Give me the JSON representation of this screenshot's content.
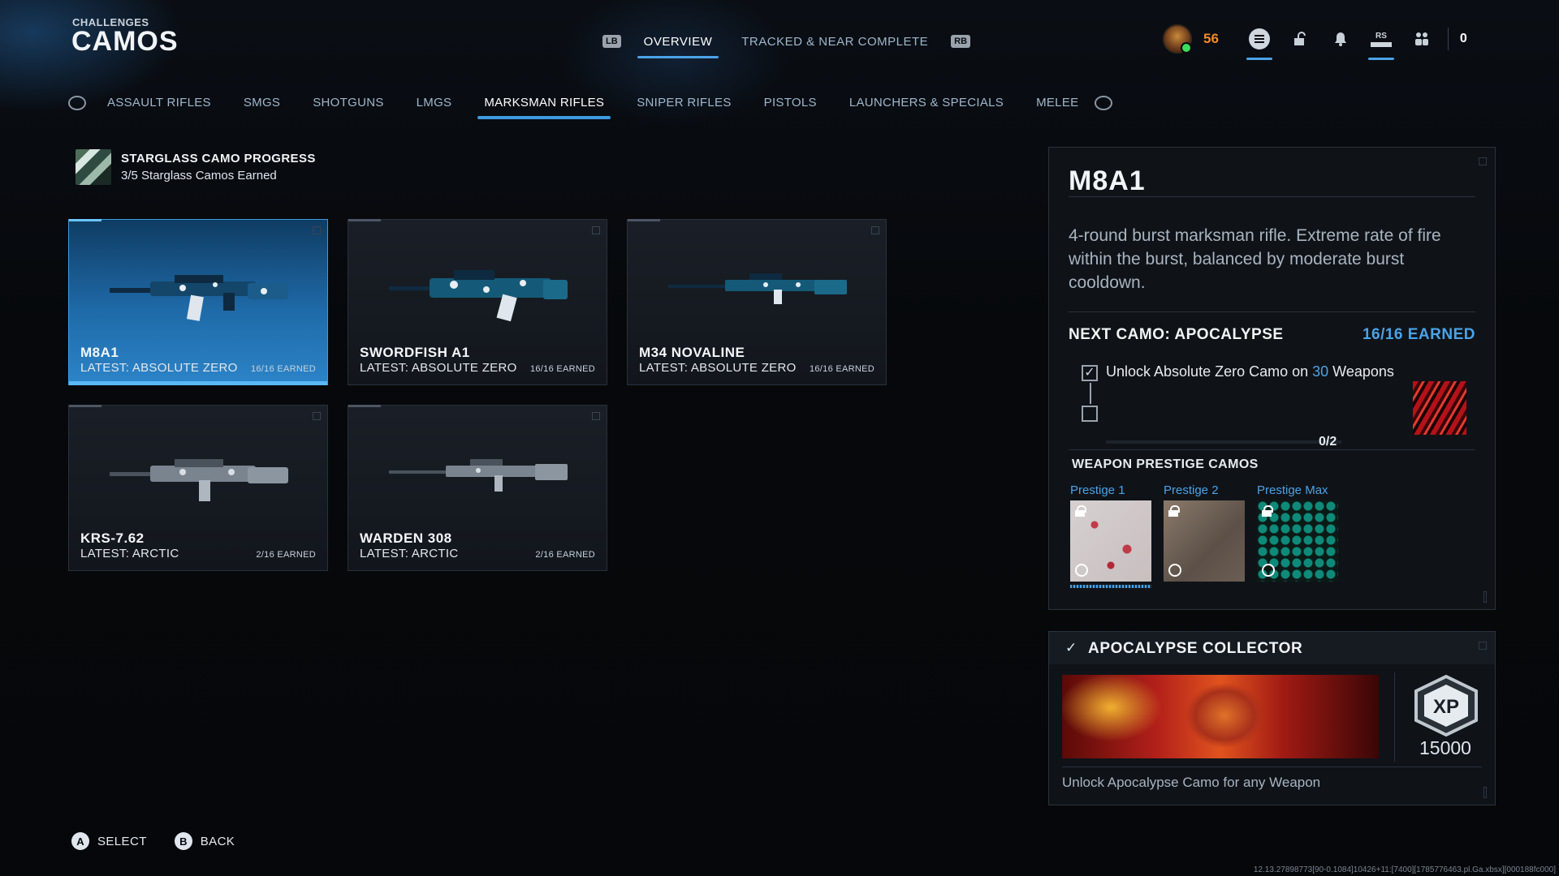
{
  "header": {
    "category": "CHALLENGES",
    "title": "CAMOS"
  },
  "top_nav": {
    "left_bumper": "LB",
    "right_bumper": "RB",
    "tabs": [
      {
        "label": "OVERVIEW",
        "active": true
      },
      {
        "label": "TRACKED & NEAR COMPLETE",
        "active": false
      }
    ]
  },
  "status_bar": {
    "level": "56",
    "rs_label": "RS",
    "count": "0",
    "icons": [
      "rank-badge-icon",
      "menu-icon",
      "store-icon",
      "notification-bell-icon",
      "social-icon",
      "party-icon"
    ]
  },
  "category_nav": {
    "items": [
      {
        "label": "ASSAULT RIFLES",
        "active": false
      },
      {
        "label": "SMGS",
        "active": false
      },
      {
        "label": "SHOTGUNS",
        "active": false
      },
      {
        "label": "LMGS",
        "active": false
      },
      {
        "label": "MARKSMAN RIFLES",
        "active": true
      },
      {
        "label": "SNIPER RIFLES",
        "active": false
      },
      {
        "label": "PISTOLS",
        "active": false
      },
      {
        "label": "LAUNCHERS & SPECIALS",
        "active": false
      },
      {
        "label": "MELEE",
        "active": false
      }
    ]
  },
  "starglass": {
    "title": "STARGLASS CAMO PROGRESS",
    "subtitle": "3/5 Starglass Camos Earned"
  },
  "weapons": [
    {
      "name": "M8A1",
      "latest": "LATEST: ABSOLUTE ZERO",
      "earned": "16/16 EARNED",
      "selected": true,
      "camo_color": "#1f7fb0"
    },
    {
      "name": "SWORDFISH A1",
      "latest": "LATEST: ABSOLUTE ZERO",
      "earned": "16/16 EARNED",
      "selected": false,
      "camo_color": "#1f7fb0"
    },
    {
      "name": "M34 NOVALINE",
      "latest": "LATEST: ABSOLUTE ZERO",
      "earned": "16/16 EARNED",
      "selected": false,
      "camo_color": "#1f7fb0"
    },
    {
      "name": "KRS-7.62",
      "latest": "LATEST: ARCTIC",
      "earned": "2/16 EARNED",
      "selected": false,
      "camo_color": "#9aa3ad"
    },
    {
      "name": "WARDEN 308",
      "latest": "LATEST: ARCTIC",
      "earned": "2/16 EARNED",
      "selected": false,
      "camo_color": "#9aa3ad"
    }
  ],
  "detail": {
    "title": "M8A1",
    "description": "4-round burst marksman rifle. Extreme rate of fire within the burst, balanced by moderate burst cooldown.",
    "next_camo": "NEXT CAMO: APOCALYPSE",
    "next_earned": "16/16 EARNED",
    "challenge_prefix": "Unlock Absolute Zero Camo on ",
    "challenge_count": "30",
    "challenge_suffix": " Weapons",
    "progress": "0/2",
    "progress_fraction": 0,
    "prestige_title": "WEAPON PRESTIGE CAMOS",
    "prestige": [
      {
        "label": "Prestige 1",
        "locked": true
      },
      {
        "label": "Prestige 2",
        "locked": true
      },
      {
        "label": "Prestige Max",
        "locked": true
      }
    ]
  },
  "collector": {
    "title": "APOCALYPSE COLLECTOR",
    "xp_label": "XP",
    "xp_value": "15000",
    "description": "Unlock Apocalypse Camo for any Weapon"
  },
  "footer": {
    "buttons": [
      {
        "glyph": "A",
        "label": "SELECT"
      },
      {
        "glyph": "B",
        "label": "BACK"
      }
    ],
    "build": "12.13.27898773[90-0.1084]10426+11:[7400][1785776463.pl.Ga.xbsx][000188fc000]"
  },
  "colors": {
    "accent": "#4aa3e8",
    "level": "#f08a2a",
    "selected_card": "#2c84c8"
  }
}
